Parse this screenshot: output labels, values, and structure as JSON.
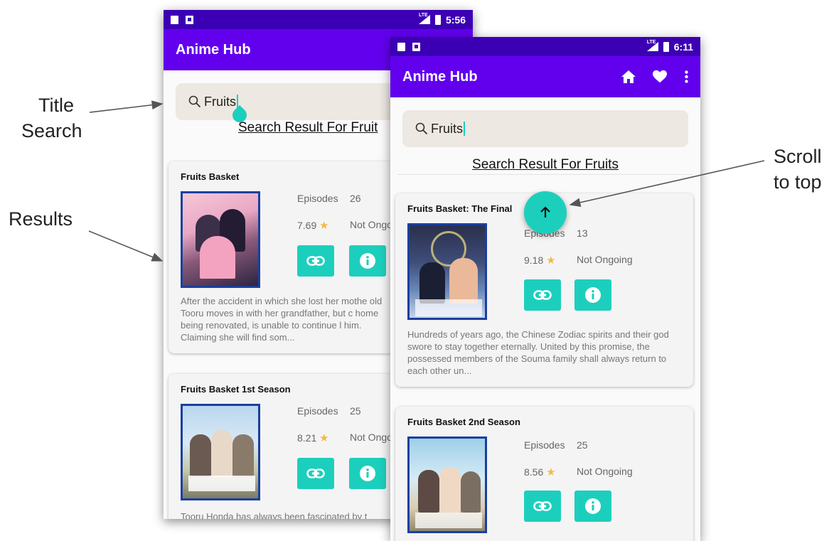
{
  "annotations": {
    "title_search": [
      "Title",
      "Search"
    ],
    "results": "Results",
    "scroll_to_top": [
      "Scroll",
      "to top"
    ]
  },
  "screen1": {
    "status": {
      "time": "5:56",
      "signal": "LTE"
    },
    "appbar_title": "Anime Hub",
    "search_value": "Fruits",
    "result_heading": "Search Result For Fruit",
    "cards": [
      {
        "title": "Fruits Basket",
        "episodes_label": "Episodes",
        "episodes": "26",
        "score": "7.69",
        "status": "Not Ongoi",
        "desc": "After the accident in which she lost her mothe old Tooru moves in with her grandfather, but c home being renovated, is unable to continue l him. Claiming she will find som..."
      },
      {
        "title": "Fruits Basket 1st Season",
        "episodes_label": "Episodes",
        "episodes": "25",
        "score": "8.21",
        "status": "Not Ongo",
        "desc": "Tooru Honda has always been fascinated by t"
      }
    ]
  },
  "screen2": {
    "status": {
      "time": "6:11",
      "signal": "LTE"
    },
    "appbar_title": "Anime Hub",
    "search_value": "Fruits",
    "result_heading": "Search Result For Fruits",
    "cards": [
      {
        "title": "Fruits Basket: The Final",
        "episodes_label": "Episodes",
        "episodes": "13",
        "score": "9.18",
        "status": "Not Ongoing",
        "desc": "Hundreds of years ago, the Chinese Zodiac spirits and their god swore to stay together eternally. United by this promise, the possessed members of the Souma family shall always return to each other un..."
      },
      {
        "title": "Fruits Basket 2nd Season",
        "episodes_label": "Episodes",
        "episodes": "25",
        "score": "8.56",
        "status": "Not Ongoing"
      }
    ]
  },
  "colors": {
    "status_bar": "#3c00b4",
    "app_bar": "#6200ee",
    "accent_teal": "#1ccfbd",
    "star": "#f5b942"
  }
}
